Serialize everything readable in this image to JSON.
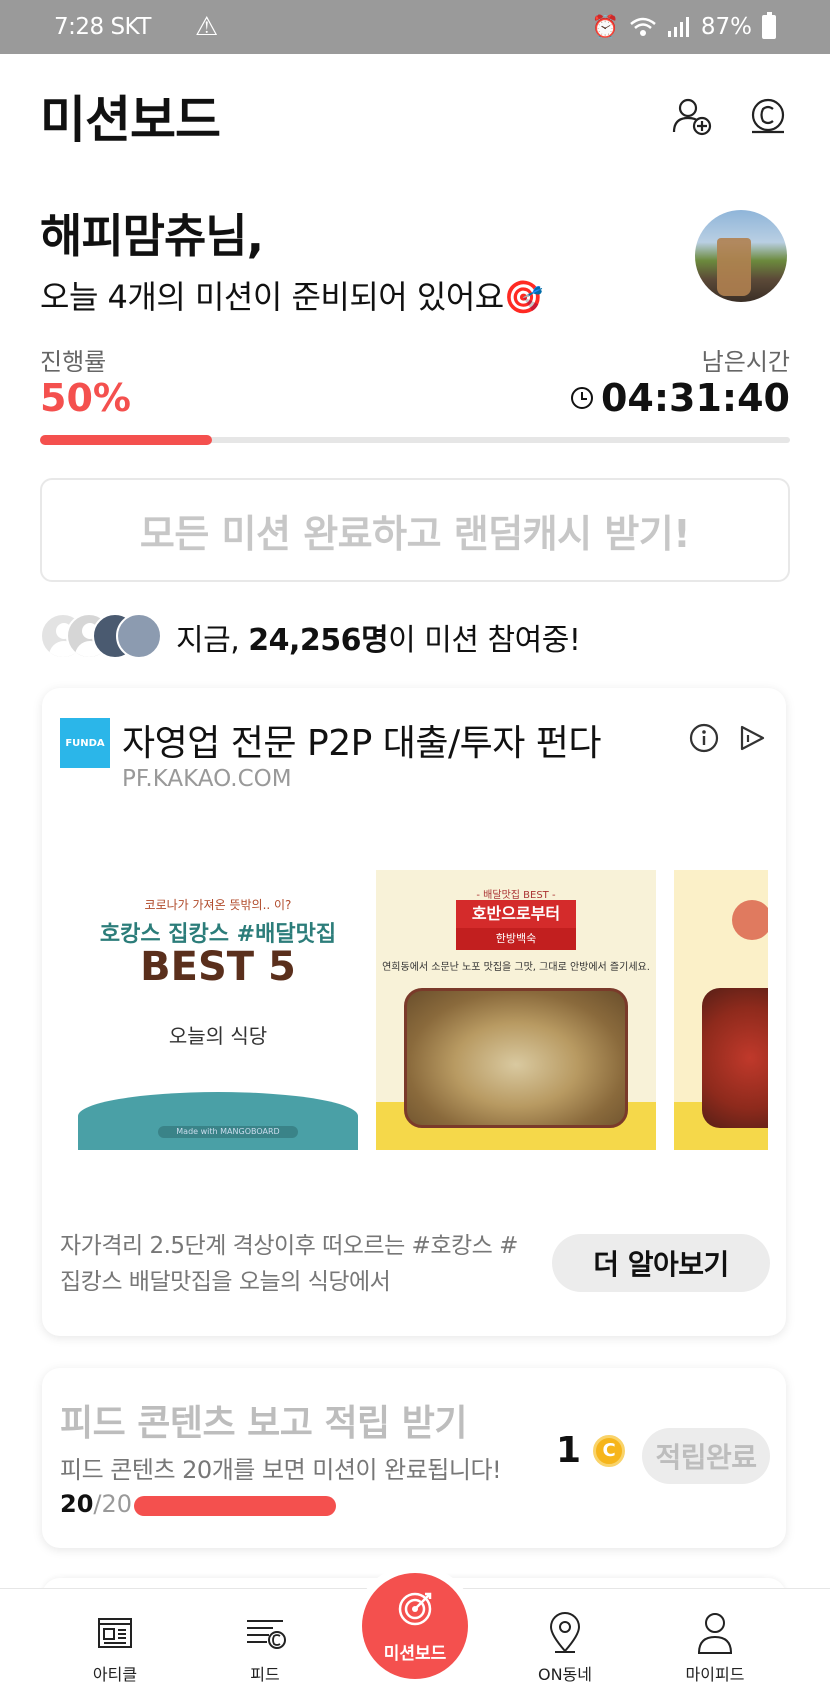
{
  "status_bar": {
    "time": "7:28 SKT",
    "battery": "87%"
  },
  "header": {
    "title": "미션보드",
    "icons": [
      "add-friend-icon",
      "cash-coin-icon"
    ]
  },
  "greeting": {
    "name": "해피맘츄님,",
    "subtitle": "오늘 4개의 미션이 준비되어 있어요🎯"
  },
  "progress": {
    "label": "진행률",
    "value": "50%",
    "fraction": 0.5,
    "remaining_label": "남은시간",
    "remaining_time": "04:31:40",
    "accent_color": "#f4504e"
  },
  "random_cash_button": "모든 미션 완료하고 랜덤캐시 받기!",
  "participants": {
    "prefix": "지금, ",
    "count": "24,256명",
    "suffix": "이 미션 참여중!"
  },
  "ad": {
    "logo_text": "FUNDA",
    "title": "자영업 전문 P2P 대출/투자 펀다",
    "domain": "PF.KAKAO.COM",
    "image1": {
      "line1": "코로나가 가져온 뜻밖의.. 이?",
      "line2": "호캉스 집캉스 #배달맛집",
      "line3": "BEST 5",
      "line4": "오늘의 식당",
      "made": "Made with MANGOBOARD"
    },
    "image2": {
      "caption": "- 배달맛집 BEST -",
      "banner": "호반으로부터",
      "banner2": "한방백숙",
      "desc": "연희동에서 소문난 노포 맛집을 그맛, 그대로 안방에서 즐기세요."
    },
    "description": "자가격리 2.5단계 격상이후 떠오르는 #호캉스 #집캉스 배달맛집을 오늘의 식당에서",
    "cta": "더 알아보기"
  },
  "mission": {
    "title": "피드 콘텐츠 보고 적립 받기",
    "description": "피드 콘텐츠 20개를 보면 미션이 완료됩니다!",
    "progress_current": "20",
    "progress_total": "/20",
    "progress_fraction": 1.0,
    "reward": "1",
    "coin_symbol": "C",
    "button": "적립완료"
  },
  "tabbar": {
    "items": [
      {
        "label": "아티클",
        "icon": "article-icon"
      },
      {
        "label": "피드",
        "icon": "feed-icon"
      },
      {
        "label": "미션보드",
        "icon": "target-icon"
      },
      {
        "label": "ON동네",
        "icon": "location-pin-icon"
      },
      {
        "label": "마이피드",
        "icon": "person-icon"
      }
    ]
  }
}
